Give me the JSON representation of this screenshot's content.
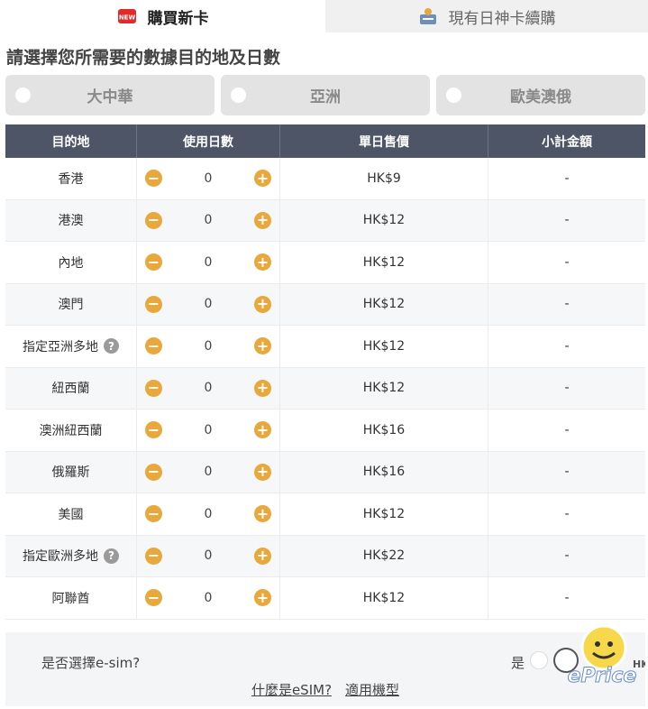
{
  "tabs": {
    "buy_new": "購買新卡",
    "renew": "現有日神卡續購",
    "new_badge": "NEW"
  },
  "heading": "請選擇您所需要的數據目的地及日數",
  "regions": [
    "大中華",
    "亞洲",
    "歐美澳俄"
  ],
  "table": {
    "headers": [
      "目的地",
      "使用日數",
      "單日售價",
      "小計金額"
    ],
    "rows": [
      {
        "dest": "香港",
        "qty": "0",
        "price": "HK$9",
        "subtotal": "-",
        "help": false
      },
      {
        "dest": "港澳",
        "qty": "0",
        "price": "HK$12",
        "subtotal": "-",
        "help": false
      },
      {
        "dest": "內地",
        "qty": "0",
        "price": "HK$12",
        "subtotal": "-",
        "help": false
      },
      {
        "dest": "澳門",
        "qty": "0",
        "price": "HK$12",
        "subtotal": "-",
        "help": false
      },
      {
        "dest": "指定亞洲多地",
        "qty": "0",
        "price": "HK$12",
        "subtotal": "-",
        "help": true
      },
      {
        "dest": "紐西蘭",
        "qty": "0",
        "price": "HK$12",
        "subtotal": "-",
        "help": false
      },
      {
        "dest": "澳洲紐西蘭",
        "qty": "0",
        "price": "HK$16",
        "subtotal": "-",
        "help": false
      },
      {
        "dest": "俄羅斯",
        "qty": "0",
        "price": "HK$16",
        "subtotal": "-",
        "help": false
      },
      {
        "dest": "美國",
        "qty": "0",
        "price": "HK$12",
        "subtotal": "-",
        "help": false
      },
      {
        "dest": "指定歐洲多地",
        "qty": "0",
        "price": "HK$22",
        "subtotal": "-",
        "help": true
      },
      {
        "dest": "阿聯酋",
        "qty": "0",
        "price": "HK$12",
        "subtotal": "-",
        "help": false
      }
    ]
  },
  "esim": {
    "question": "是否選擇e-sim?",
    "yes": "是",
    "link_what": "什麼是eSIM?",
    "link_devices": "適用機型"
  },
  "icons": {
    "help": "?",
    "minus": "−",
    "plus": "+"
  },
  "watermark": {
    "brand": "ePrice",
    "region": "HK"
  },
  "colors": {
    "accent": "#e8a83c",
    "header_bg": "#4d5567",
    "region_bg": "#e3e3e3"
  }
}
